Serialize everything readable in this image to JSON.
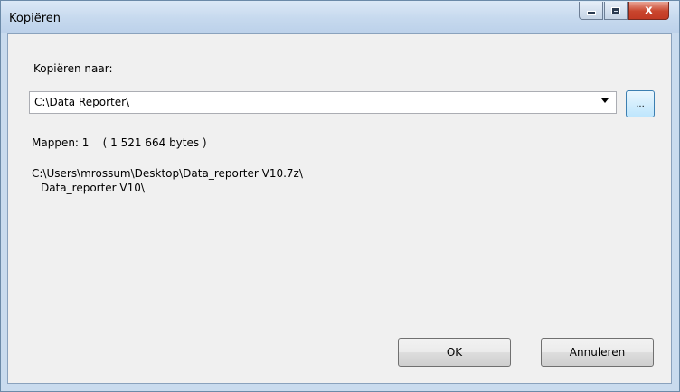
{
  "window": {
    "title": "Kopiëren",
    "caption": {
      "minimize_icon": "minimize-icon",
      "maximize_icon": "maximize-icon",
      "close_glyph": "x"
    }
  },
  "form": {
    "target_label": "Kopiëren naar:",
    "target_value": "C:\\Data Reporter\\",
    "browse_label": "...",
    "folders_text": "Mappen: 1    ( 1 521 664 bytes )",
    "source_path_line1": "C:\\Users\\mrossum\\Desktop\\Data_reporter V10.7z\\",
    "source_path_line2": "Data_reporter V10\\"
  },
  "buttons": {
    "ok_label": "OK",
    "cancel_label": "Annuleren"
  },
  "colors": {
    "title_bar": "#c6d9ee",
    "close_button": "#c9452d",
    "client_bg": "#f0f0f0"
  }
}
